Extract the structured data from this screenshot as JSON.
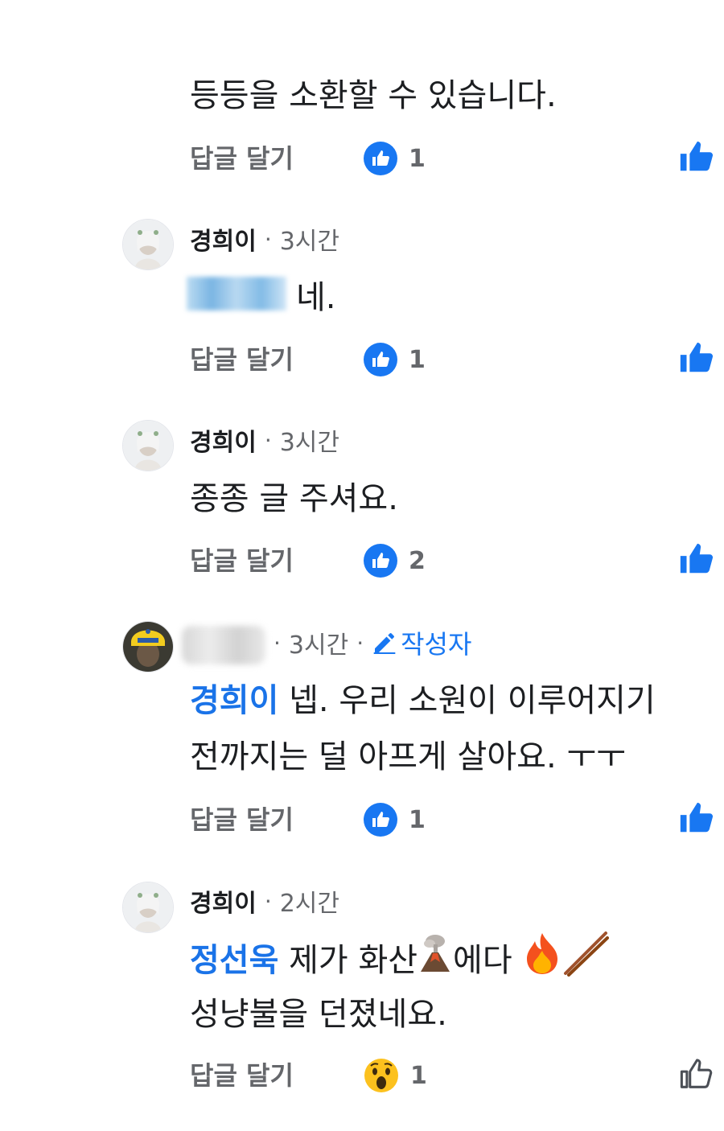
{
  "comments": [
    {
      "text": "등등을 소환할 수 있습니다.",
      "actions": {
        "reply_label": "답글 달기",
        "reaction_count": "1",
        "reaction_type": "like-icon"
      }
    },
    {
      "author": "경희이",
      "time": "3시간",
      "text": "네.",
      "actions": {
        "reply_label": "답글 달기",
        "reaction_count": "1",
        "reaction_type": "like-icon"
      }
    },
    {
      "author": "경희이",
      "time": "3시간",
      "text": "종종 글 주셔요.",
      "actions": {
        "reply_label": "답글 달기",
        "reaction_count": "2",
        "reaction_type": "like-icon"
      }
    },
    {
      "author": "",
      "time": "3시간",
      "author_badge": "작성자",
      "mention": "경희이",
      "text_line1": "넵. 우리 소원이 이루어지기",
      "text_line2": "전까지는 덜 아프게 살아요. ㅜㅜ",
      "actions": {
        "reply_label": "답글 달기",
        "reaction_count": "1",
        "reaction_type": "like-icon"
      }
    },
    {
      "author": "경희이",
      "time": "2시간",
      "mention": "정선욱",
      "text_part1": "제가 화산",
      "text_part2": "에다",
      "text_line2": "성냥불을 던졌네요.",
      "emojis": [
        "volcano-emoji",
        "fire-emoji",
        "chopsticks-emoji"
      ],
      "actions": {
        "reply_label": "답글 달기",
        "reaction_count": "1",
        "reaction_type": "wow-emoji"
      }
    }
  ],
  "separator": "·",
  "colors": {
    "mention": "#1a73e8",
    "like": "#1877f2",
    "meta": "#65676b",
    "text": "#1c1e21"
  }
}
